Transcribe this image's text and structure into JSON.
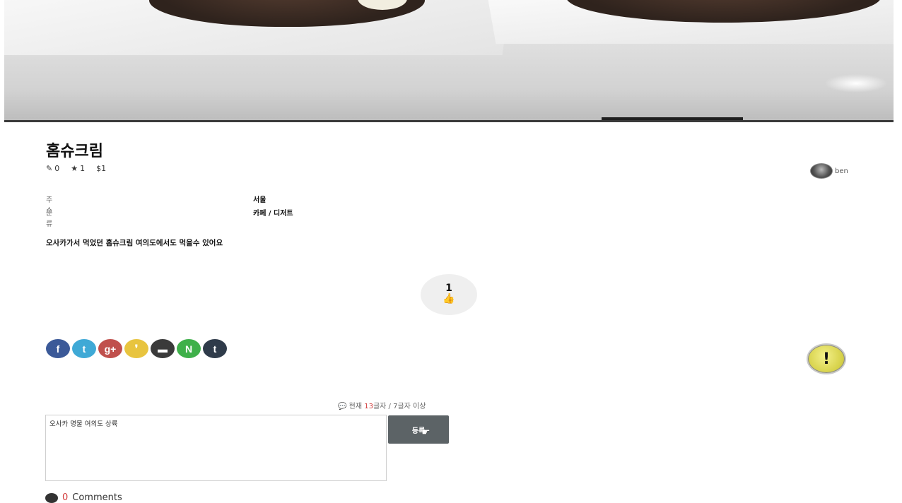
{
  "post": {
    "title": "홈슈크림",
    "stats": {
      "edits": "0",
      "stars": "1",
      "price": "$1"
    },
    "author": {
      "name": "ben"
    },
    "info": [
      {
        "key": "주소",
        "value": "서울"
      },
      {
        "key": "분류",
        "value": "카페 / 디저트"
      }
    ],
    "description": "오사카가서 먹었던 홈슈크림 여의도에서도 먹을수 있어요",
    "likes": "1"
  },
  "share": {
    "buttons": [
      {
        "name": "facebook",
        "glyph": "f",
        "color": "#3b5998"
      },
      {
        "name": "twitter",
        "glyph": "t",
        "color": "#3fa9d6"
      },
      {
        "name": "google-plus",
        "glyph": "g+",
        "color": "#c0504d"
      },
      {
        "name": "kakao",
        "glyph": "❜",
        "color": "#e8c43f"
      },
      {
        "name": "band",
        "glyph": "▬",
        "color": "#3a3a3a"
      },
      {
        "name": "naver",
        "glyph": "N",
        "color": "#3fb04a"
      },
      {
        "name": "tumblr",
        "glyph": "t",
        "color": "#2f3b4a"
      }
    ]
  },
  "report": {
    "glyph": "!"
  },
  "comment": {
    "counter_prefix": "현재 ",
    "counter_count": "13",
    "counter_suffix": "글자 / 7글자 이상",
    "value": "오사카 명물 여의도 상륙",
    "submit_label": "등록"
  },
  "comments": {
    "count": "0",
    "label": "Comments"
  }
}
